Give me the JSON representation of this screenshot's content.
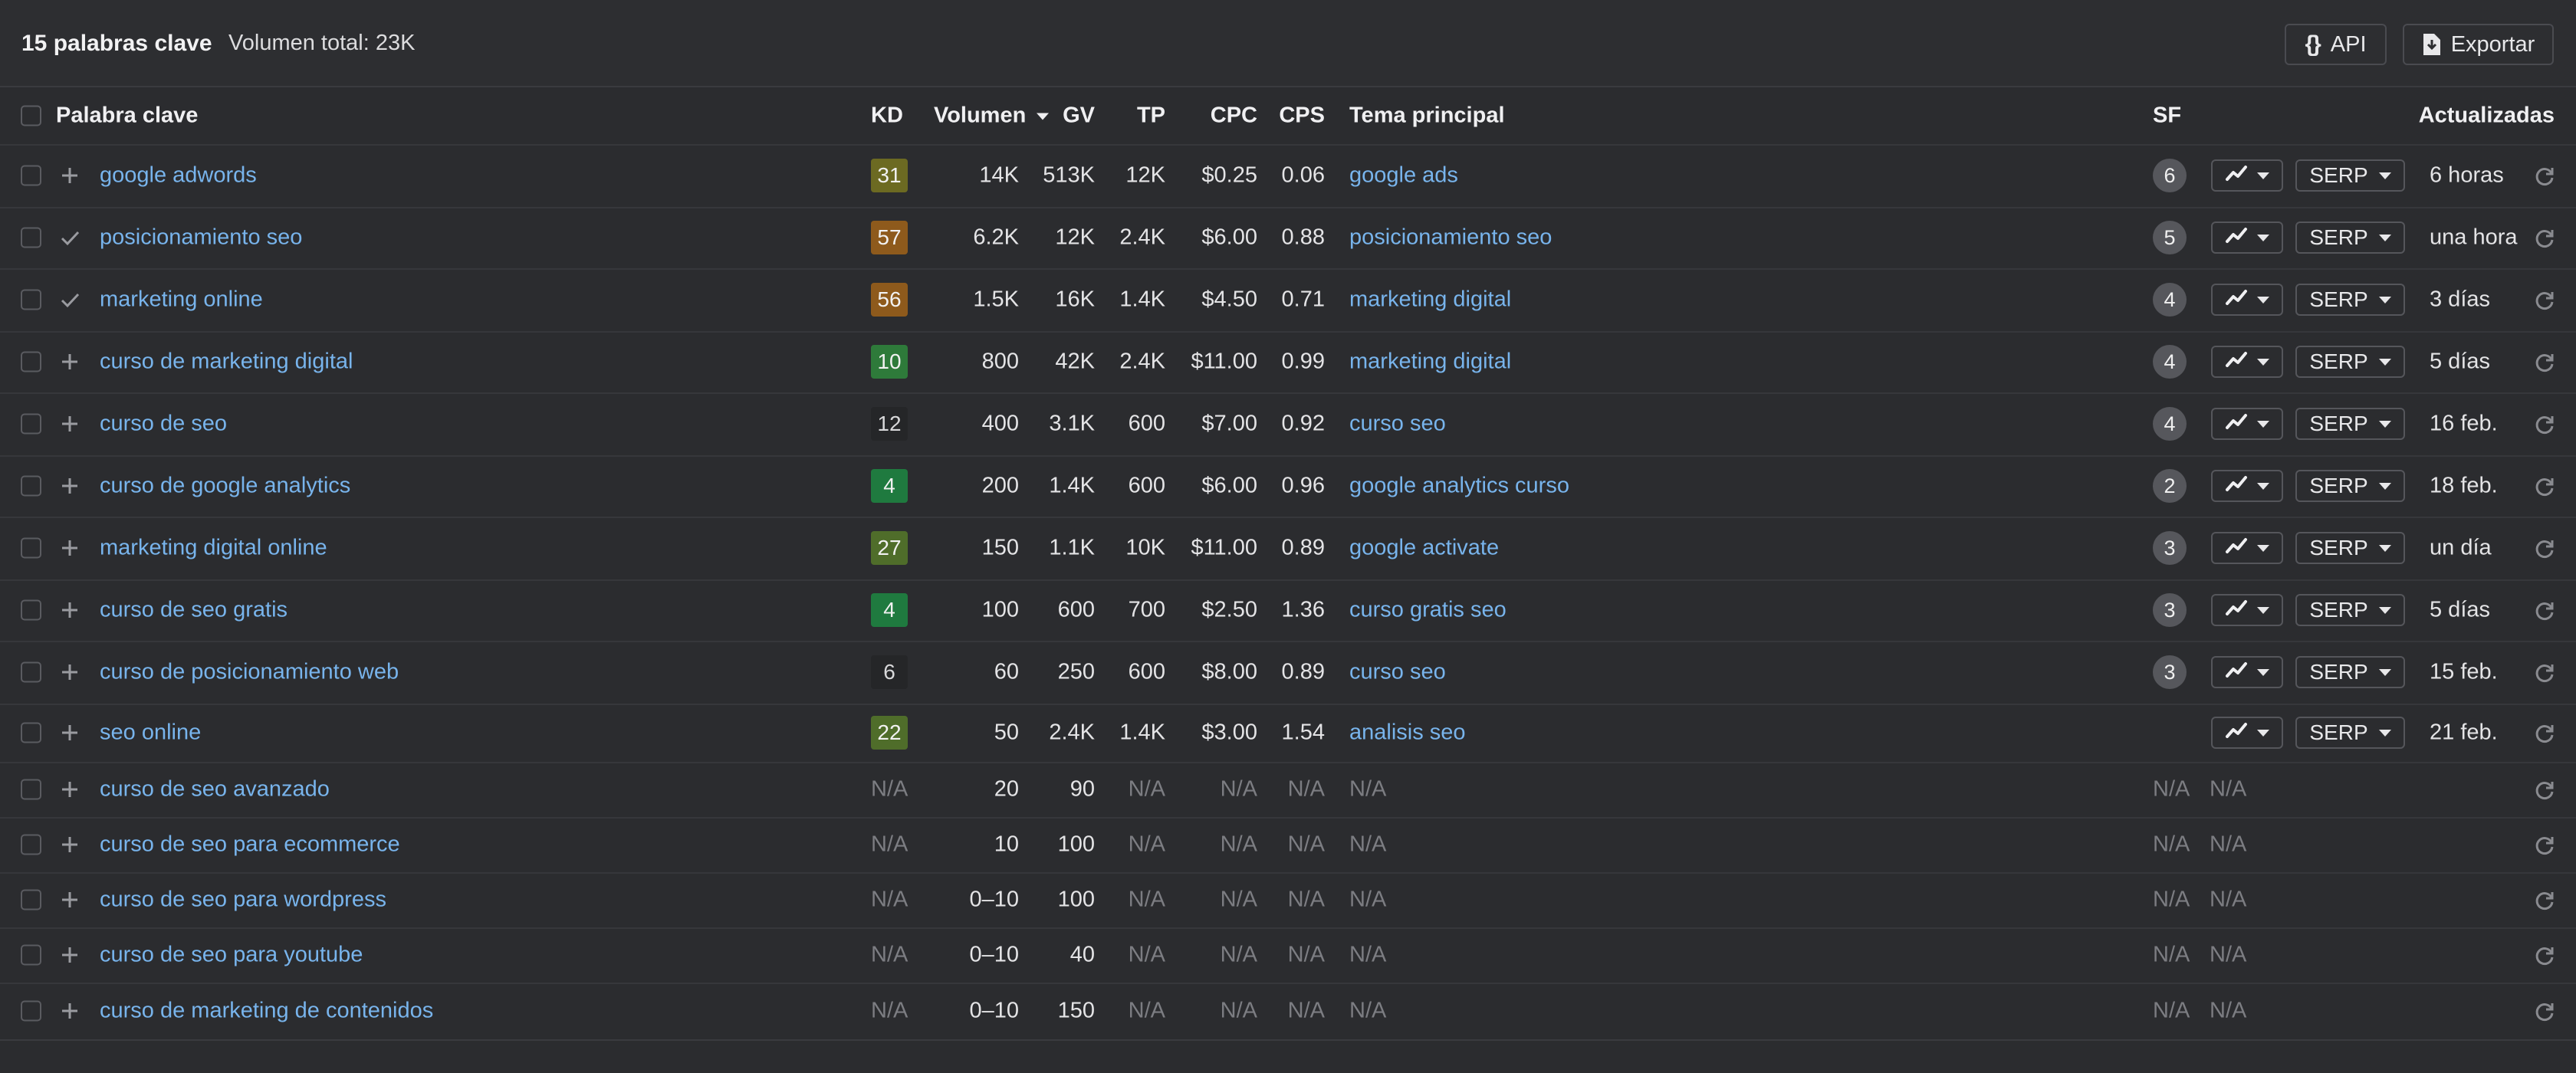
{
  "header": {
    "title": "15 palabras clave",
    "volume_total": "Volumen total: 23K",
    "api_label": "API",
    "export_label": "Exportar"
  },
  "columns": {
    "keyword": "Palabra clave",
    "kd": "KD",
    "volume": "Volumen",
    "gv": "GV",
    "tp": "TP",
    "cpc": "CPC",
    "cps": "CPS",
    "topic": "Tema principal",
    "sf": "SF",
    "updated": "Actualizadas"
  },
  "kd_colors": {
    "dark_green": "#1f7a3f",
    "green": "#2e7a3a",
    "olive_green": "#4f6d2a",
    "olive": "#6c6a22",
    "orange": "#8e5a1c",
    "dark_gray": "#252628"
  },
  "rows": [
    {
      "keyword": "google adwords",
      "action": "plus",
      "kd": "31",
      "kd_color": "#6c6a22",
      "volume": "14K",
      "gv": "513K",
      "tp": "12K",
      "cpc": "$0.25",
      "cps": "0.06",
      "topic": "google ads",
      "sf": "6",
      "serp": "SERP",
      "updated": "6 horas"
    },
    {
      "keyword": "posicionamiento seo",
      "action": "check",
      "kd": "57",
      "kd_color": "#8e5a1c",
      "volume": "6.2K",
      "gv": "12K",
      "tp": "2.4K",
      "cpc": "$6.00",
      "cps": "0.88",
      "topic": "posicionamiento seo",
      "sf": "5",
      "serp": "SERP",
      "updated": "una hora"
    },
    {
      "keyword": "marketing online",
      "action": "check",
      "kd": "56",
      "kd_color": "#8e5a1c",
      "volume": "1.5K",
      "gv": "16K",
      "tp": "1.4K",
      "cpc": "$4.50",
      "cps": "0.71",
      "topic": "marketing digital",
      "sf": "4",
      "serp": "SERP",
      "updated": "3 días"
    },
    {
      "keyword": "curso de marketing digital",
      "action": "plus",
      "kd": "10",
      "kd_color": "#2e7a3a",
      "volume": "800",
      "gv": "42K",
      "tp": "2.4K",
      "cpc": "$11.00",
      "cps": "0.99",
      "topic": "marketing digital",
      "sf": "4",
      "serp": "SERP",
      "updated": "5 días"
    },
    {
      "keyword": "curso de seo",
      "action": "plus",
      "kd": "12",
      "kd_color": "#252628",
      "volume": "400",
      "gv": "3.1K",
      "tp": "600",
      "cpc": "$7.00",
      "cps": "0.92",
      "topic": "curso seo",
      "sf": "4",
      "serp": "SERP",
      "updated": "16 feb."
    },
    {
      "keyword": "curso de google analytics",
      "action": "plus",
      "kd": "4",
      "kd_color": "#1f7a3f",
      "volume": "200",
      "gv": "1.4K",
      "tp": "600",
      "cpc": "$6.00",
      "cps": "0.96",
      "topic": "google analytics curso",
      "sf": "2",
      "serp": "SERP",
      "updated": "18 feb."
    },
    {
      "keyword": "marketing digital online",
      "action": "plus",
      "kd": "27",
      "kd_color": "#4f6d2a",
      "volume": "150",
      "gv": "1.1K",
      "tp": "10K",
      "cpc": "$11.00",
      "cps": "0.89",
      "topic": "google activate",
      "sf": "3",
      "serp": "SERP",
      "updated": "un día"
    },
    {
      "keyword": "curso de seo gratis",
      "action": "plus",
      "kd": "4",
      "kd_color": "#1f7a3f",
      "volume": "100",
      "gv": "600",
      "tp": "700",
      "cpc": "$2.50",
      "cps": "1.36",
      "topic": "curso gratis seo",
      "sf": "3",
      "serp": "SERP",
      "updated": "5 días"
    },
    {
      "keyword": "curso de posicionamiento web",
      "action": "plus",
      "kd": "6",
      "kd_color": "#252628",
      "volume": "60",
      "gv": "250",
      "tp": "600",
      "cpc": "$8.00",
      "cps": "0.89",
      "topic": "curso seo",
      "sf": "3",
      "serp": "SERP",
      "updated": "15 feb."
    },
    {
      "keyword": "seo online",
      "action": "plus",
      "kd": "22",
      "kd_color": "#4f6d2a",
      "volume": "50",
      "gv": "2.4K",
      "tp": "1.4K",
      "cpc": "$3.00",
      "cps": "1.54",
      "topic": "analisis seo",
      "sf": "",
      "serp": "SERP",
      "updated": "21 feb."
    },
    {
      "keyword": "curso de seo avanzado",
      "action": "plus",
      "kd": "N/A",
      "volume": "20",
      "gv": "90",
      "tp": "N/A",
      "cpc": "N/A",
      "cps": "N/A",
      "topic": "N/A",
      "sf": "N/A",
      "trend_na": "N/A",
      "updated": ""
    },
    {
      "keyword": "curso de seo para ecommerce",
      "action": "plus",
      "kd": "N/A",
      "volume": "10",
      "gv": "100",
      "tp": "N/A",
      "cpc": "N/A",
      "cps": "N/A",
      "topic": "N/A",
      "sf": "N/A",
      "trend_na": "N/A",
      "updated": ""
    },
    {
      "keyword": "curso de seo para wordpress",
      "action": "plus",
      "kd": "N/A",
      "volume": "0–10",
      "gv": "100",
      "tp": "N/A",
      "cpc": "N/A",
      "cps": "N/A",
      "topic": "N/A",
      "sf": "N/A",
      "trend_na": "N/A",
      "updated": ""
    },
    {
      "keyword": "curso de seo para youtube",
      "action": "plus",
      "kd": "N/A",
      "volume": "0–10",
      "gv": "40",
      "tp": "N/A",
      "cpc": "N/A",
      "cps": "N/A",
      "topic": "N/A",
      "sf": "N/A",
      "trend_na": "N/A",
      "updated": ""
    },
    {
      "keyword": "curso de marketing de contenidos",
      "action": "plus",
      "kd": "N/A",
      "volume": "0–10",
      "gv": "150",
      "tp": "N/A",
      "cpc": "N/A",
      "cps": "N/A",
      "topic": "N/A",
      "sf": "N/A",
      "trend_na": "N/A",
      "updated": ""
    }
  ]
}
